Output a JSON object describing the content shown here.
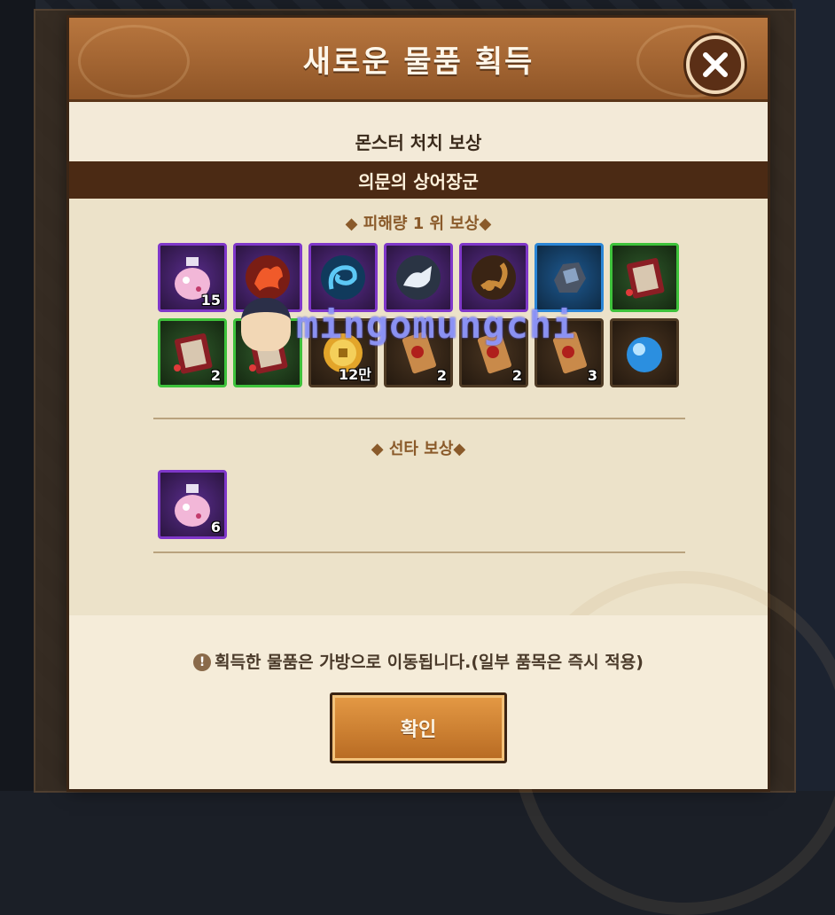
{
  "dialog": {
    "title": "새로운 물품 획득",
    "section_title": "몬스터 처치 보상",
    "monster_name": "의문의 상어장군"
  },
  "damage_rewards": {
    "label": "◆ 피해량 1 위 보상◆",
    "items": [
      {
        "rarity": "purple",
        "icon": "potion-icon",
        "qty": "15"
      },
      {
        "rarity": "purple",
        "icon": "fire-bird-icon",
        "qty": ""
      },
      {
        "rarity": "purple",
        "icon": "blue-dragon-icon",
        "qty": ""
      },
      {
        "rarity": "purple",
        "icon": "white-tiger-icon",
        "qty": ""
      },
      {
        "rarity": "purple",
        "icon": "scorpion-icon",
        "qty": ""
      },
      {
        "rarity": "blue",
        "icon": "ore-icon",
        "qty": ""
      },
      {
        "rarity": "green",
        "icon": "scroll-card-icon",
        "qty": ""
      },
      {
        "rarity": "green",
        "icon": "scroll-card-icon",
        "qty": "2"
      },
      {
        "rarity": "green",
        "icon": "scroll-card-icon",
        "qty": ""
      },
      {
        "rarity": "brown",
        "icon": "gold-coin-icon",
        "qty": "12만"
      },
      {
        "rarity": "brown",
        "icon": "ticket-icon",
        "qty": "2"
      },
      {
        "rarity": "brown",
        "icon": "ticket-icon",
        "qty": "2"
      },
      {
        "rarity": "brown",
        "icon": "ticket-icon",
        "qty": "3"
      },
      {
        "rarity": "brown",
        "icon": "blue-orb-icon",
        "qty": ""
      }
    ]
  },
  "first_hit_rewards": {
    "label": "◆ 선타 보상◆",
    "items": [
      {
        "rarity": "purple",
        "icon": "potion-icon",
        "qty": "6"
      }
    ]
  },
  "footer": {
    "notice": "획득한 물품은 가방으로 이동됩니다.(일부 품목은 즉시 적용)",
    "confirm_label": "확인"
  },
  "watermark": {
    "text": "mingomungchi"
  },
  "colors": {
    "header": "#a0642f",
    "purple": "#7f37c9",
    "blue": "#2b86d6",
    "green": "#3ec23b",
    "brown": "#4e3a24"
  }
}
